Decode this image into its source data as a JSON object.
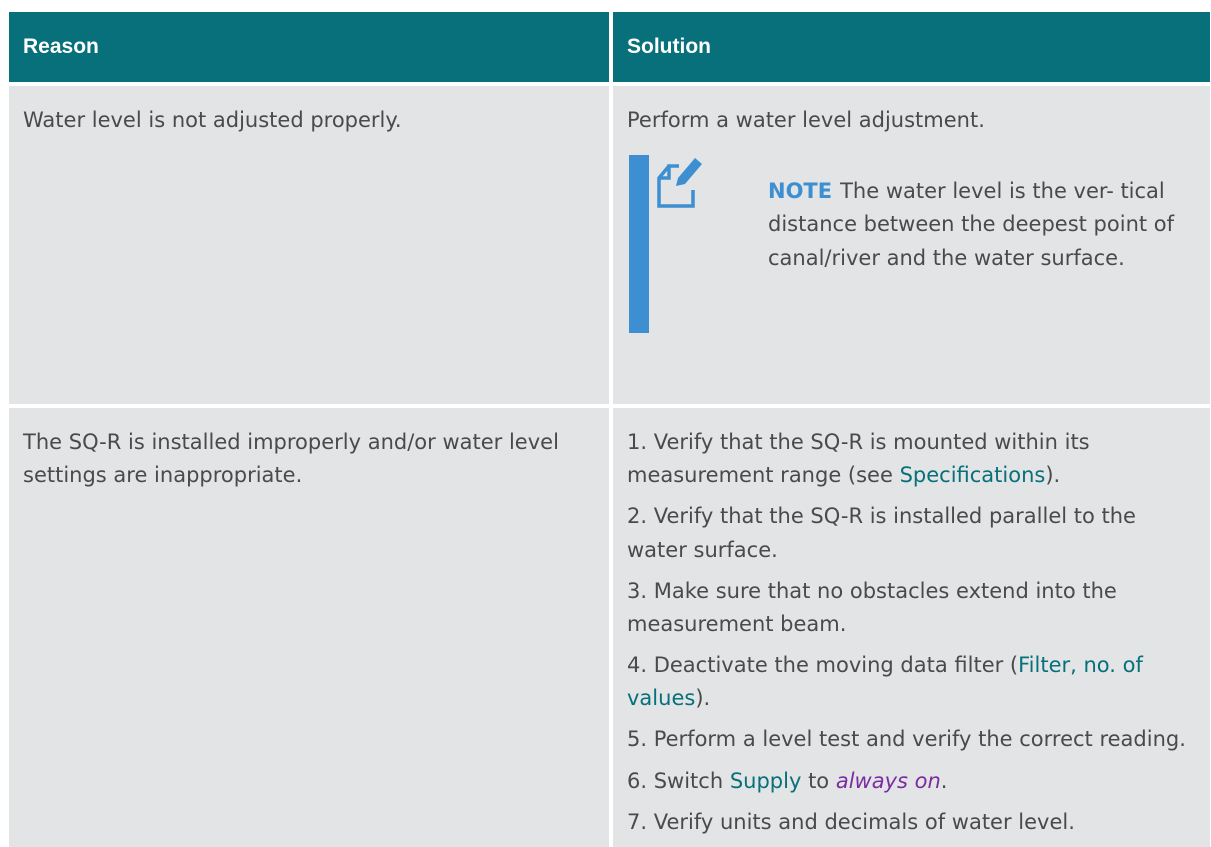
{
  "header": {
    "reason": "Reason",
    "solution": "Solution"
  },
  "rows": [
    {
      "reason": "Water level is not adjusted properly.",
      "solution": "Perform a water level adjustment.",
      "note": {
        "label": "NOTE",
        "text": "The water level is the ver- tical distance between the deepest point of canal/river and the water surface.",
        "icon": "note-edit-icon"
      }
    },
    {
      "reason": "The SQ-R is installed improperly and/or water level settings are inappropriate.",
      "steps": [
        {
          "before": "1. Verify that the SQ-R is mounted within its measurement range (see ",
          "link": "Specifications",
          "after": ")."
        },
        {
          "before": "2. Verify that the SQ-R is installed parallel to the water surface."
        },
        {
          "before": "3. Make sure that no obstacles extend into the measurement beam."
        },
        {
          "before": "4. Deactivate the moving data filter (",
          "link": "Filter, no. of values",
          "after": ")."
        },
        {
          "before": "5. Perform a level test and verify the correct reading."
        },
        {
          "before": "6. Switch ",
          "link": "Supply",
          "middle": " to ",
          "emphasis": "always on",
          "after": "."
        },
        {
          "before": "7. Verify units and decimals of water level."
        }
      ]
    }
  ],
  "colors": {
    "header_bg": "#07707a",
    "cell_bg": "#e2e4e5",
    "note_accent": "#3d8fd1",
    "link": "#07707a",
    "emphasis": "#7a2ca0"
  }
}
